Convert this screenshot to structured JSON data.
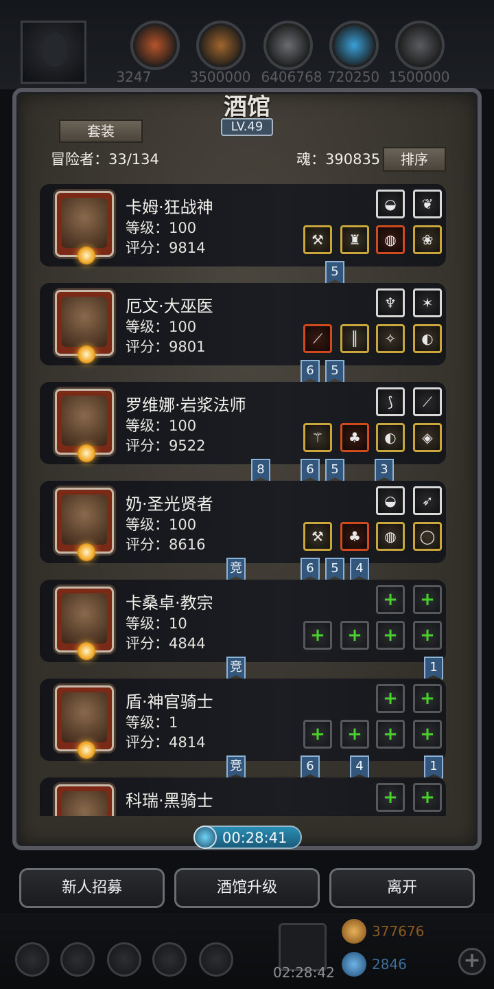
{
  "resources": [
    {
      "name": "wood",
      "value": "3247",
      "color": "#b5542a"
    },
    {
      "name": "lumber",
      "value": "3500000",
      "color": "#a0652c"
    },
    {
      "name": "iron",
      "value": "6406768",
      "color": "#6a6c70"
    },
    {
      "name": "crystal",
      "value": "720250",
      "color": "#3aa0d8"
    },
    {
      "name": "steel",
      "value": "1500000",
      "color": "#5a5c60"
    }
  ],
  "tavern": {
    "title": "酒馆",
    "level": "LV.49",
    "set_button": "套装",
    "adventurers": "冒险者：33/134",
    "soul": "魂：390835",
    "sort_button": "排序"
  },
  "heroes": [
    {
      "name": "卡姆·狂战神",
      "level": "等级：100",
      "score": "评分：9814",
      "skills": [
        {
          "g": "◒",
          "c": "white"
        },
        {
          "g": "❦",
          "c": "white"
        }
      ],
      "gear": [
        {
          "g": "⚒",
          "c": "gold"
        },
        {
          "g": "♜",
          "c": "gold"
        },
        {
          "g": "◍",
          "c": "red"
        },
        {
          "g": "❀",
          "c": "gold"
        }
      ],
      "tags": [
        {
          "t": "5",
          "slot": 2
        }
      ]
    },
    {
      "name": "厄文·大巫医",
      "level": "等级：100",
      "score": "评分：9801",
      "skills": [
        {
          "g": "♆",
          "c": "white"
        },
        {
          "g": "✶",
          "c": "white"
        }
      ],
      "gear": [
        {
          "g": "⟋",
          "c": "red"
        },
        {
          "g": "║",
          "c": "gold"
        },
        {
          "g": "✧",
          "c": "gold"
        },
        {
          "g": "◐",
          "c": "gold"
        }
      ],
      "tags": [
        {
          "t": "6",
          "slot": 1
        },
        {
          "t": "5",
          "slot": 2
        }
      ]
    },
    {
      "name": "罗维娜·岩浆法师",
      "level": "等级：100",
      "score": "评分：9522",
      "skills": [
        {
          "g": "⟆",
          "c": "white"
        },
        {
          "g": "⟋",
          "c": "white"
        }
      ],
      "gear": [
        {
          "g": "⚚",
          "c": "gold"
        },
        {
          "g": "♣",
          "c": "red"
        },
        {
          "g": "◐",
          "c": "gold"
        },
        {
          "g": "◈",
          "c": "gold"
        }
      ],
      "tags": [
        {
          "t": "8",
          "slot": 0
        },
        {
          "t": "6",
          "slot": 1
        },
        {
          "t": "5",
          "slot": 2
        },
        {
          "t": "3",
          "slot": 4
        }
      ]
    },
    {
      "name": "奶·圣光贤者",
      "level": "等级：100",
      "score": "评分：8616",
      "skills": [
        {
          "g": "◒",
          "c": "white"
        },
        {
          "g": "➶",
          "c": "white"
        }
      ],
      "gear": [
        {
          "g": "⚒",
          "c": "gold"
        },
        {
          "g": "♣",
          "c": "red"
        },
        {
          "g": "◍",
          "c": "gold"
        },
        {
          "g": "◯",
          "c": "gold"
        }
      ],
      "tags": [
        {
          "t": "竞",
          "slot": -1
        },
        {
          "t": "6",
          "slot": 1
        },
        {
          "t": "5",
          "slot": 2
        },
        {
          "t": "4",
          "slot": 3
        }
      ]
    },
    {
      "name": "卡桑卓·教宗",
      "level": "等级：10",
      "score": "评分：4844",
      "skills": [
        {
          "g": "+",
          "c": "empty"
        },
        {
          "g": "+",
          "c": "empty"
        }
      ],
      "gear": [
        {
          "g": "+",
          "c": "empty"
        },
        {
          "g": "+",
          "c": "empty"
        },
        {
          "g": "+",
          "c": "empty"
        },
        {
          "g": "+",
          "c": "empty"
        }
      ],
      "tags": [
        {
          "t": "竞",
          "slot": -1
        },
        {
          "t": "1",
          "slot": 5
        }
      ]
    },
    {
      "name": "盾·神官骑士",
      "level": "等级：1",
      "score": "评分：4814",
      "skills": [
        {
          "g": "+",
          "c": "empty"
        },
        {
          "g": "+",
          "c": "empty"
        }
      ],
      "gear": [
        {
          "g": "+",
          "c": "empty"
        },
        {
          "g": "+",
          "c": "empty"
        },
        {
          "g": "+",
          "c": "empty"
        },
        {
          "g": "+",
          "c": "empty"
        }
      ],
      "tags": [
        {
          "t": "竞",
          "slot": -1
        },
        {
          "t": "6",
          "slot": 1
        },
        {
          "t": "4",
          "slot": 3
        },
        {
          "t": "1",
          "slot": 5
        }
      ]
    },
    {
      "name": "科瑞·黑骑士",
      "level": "",
      "score": "",
      "skills": [
        {
          "g": "+",
          "c": "empty"
        },
        {
          "g": "+",
          "c": "empty"
        }
      ],
      "gear": [],
      "tags": []
    }
  ],
  "timer": "00:28:41",
  "buttons": {
    "recruit": "新人招募",
    "upgrade": "酒馆升级",
    "leave": "离开"
  },
  "bottom": {
    "gift_timer": "02:28:42",
    "gold": "377676",
    "gems": "2846",
    "plus": "+"
  }
}
